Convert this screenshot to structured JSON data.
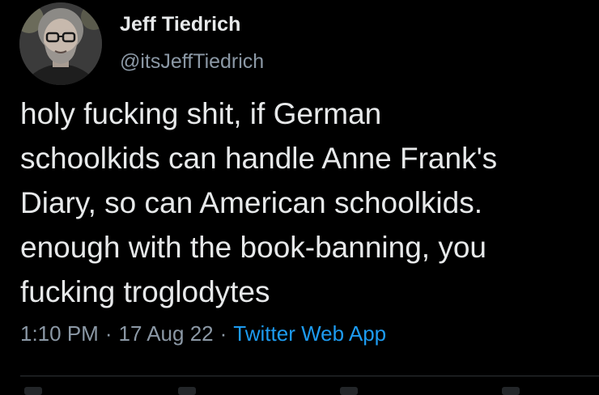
{
  "author": {
    "display_name": "Jeff Tiedrich",
    "handle": "@itsJeffTiedrich"
  },
  "tweet": {
    "text": "holy fucking shit, if German\nschoolkids can handle Anne Frank's\nDiary, so can American schoolkids.\nenough with the book-banning, you\nfucking troglodytes",
    "time": "1:10 PM",
    "date": "17 Aug 22",
    "source": "Twitter Web App",
    "separator": "·"
  },
  "colors": {
    "background": "#000000",
    "text_primary": "#e7e9ea",
    "text_secondary": "#8b98a5",
    "link": "#1d9bf0"
  },
  "icons": {
    "avatar": "profile-photo"
  }
}
